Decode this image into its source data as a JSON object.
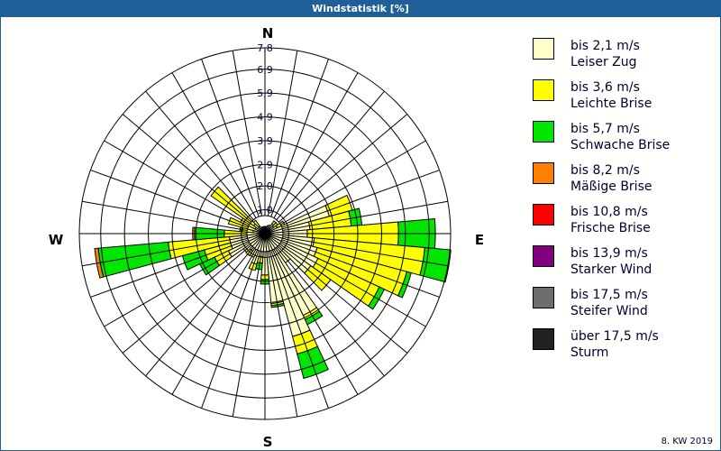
{
  "title": "Windstatistik [%]",
  "footer": "8. KW 2019",
  "chart_data": {
    "type": "windrose",
    "title": "Windstatistik [%]",
    "unit": "%",
    "compass_labels": {
      "n": "N",
      "e": "E",
      "s": "S",
      "w": "W"
    },
    "radial_ticks": [
      1.0,
      2.0,
      2.9,
      3.9,
      4.9,
      5.9,
      6.9,
      7.8
    ],
    "radial_tick_labels": [
      "1,0",
      "2,0",
      "2,9",
      "3,9",
      "4,9",
      "5,9",
      "6,9",
      "7,8"
    ],
    "rmax": 7.8,
    "grid": true,
    "legend_placement": "right",
    "directions": [
      0,
      10,
      20,
      30,
      40,
      50,
      60,
      70,
      80,
      90,
      100,
      110,
      120,
      130,
      140,
      150,
      160,
      170,
      180,
      190,
      200,
      210,
      220,
      230,
      240,
      250,
      260,
      270,
      280,
      290,
      300,
      310,
      320,
      330,
      340,
      350
    ],
    "series": [
      {
        "name": "bis 2,1 m/s",
        "desc": "Leiser Zug",
        "color": "#ffffc8",
        "values": [
          0.3,
          0.3,
          0.35,
          0.4,
          0.5,
          0.45,
          0.57,
          2.8,
          1.9,
          1.78,
          2.08,
          2.27,
          2.46,
          2.35,
          1.5,
          3.79,
          4.47,
          2.95,
          1.74,
          0.98,
          1.33,
          1.1,
          0.9,
          1.1,
          1.7,
          1.5,
          1.5,
          0.76,
          0.5,
          0.76,
          0.45,
          0.57,
          0.38,
          0.3,
          0.3,
          0.3
        ]
      },
      {
        "name": "bis 3,6 m/s",
        "desc": "Leichte Brise",
        "color": "#ffff00",
        "values": [
          0,
          0,
          0,
          0,
          0.15,
          0.2,
          0.34,
          1.0,
          1.74,
          3.83,
          4.66,
          3.9,
          2.84,
          1.02,
          0,
          0.19,
          0.76,
          0.08,
          0.19,
          0.27,
          0.27,
          0,
          0.23,
          0,
          0.64,
          1.14,
          2.58,
          0.95,
          0.45,
          0.83,
          0.68,
          2.2,
          0.3,
          0,
          0,
          0
        ]
      },
      {
        "name": "bis 5,7 m/s",
        "desc": "Schwache Brise",
        "color": "#00e600",
        "values": [
          0,
          0,
          0,
          0,
          0,
          0,
          0,
          0,
          0.45,
          1.55,
          1.1,
          0.19,
          0.23,
          0,
          0,
          0.23,
          1.06,
          0.08,
          0.19,
          0.27,
          0,
          0,
          0,
          0,
          0.68,
          0.95,
          2.95,
          1.25,
          0.11,
          0,
          0,
          0,
          0,
          0,
          0,
          0
        ]
      },
      {
        "name": "bis 8,2 m/s",
        "desc": "Mäßige Brise",
        "color": "#ff8000",
        "values": [
          0,
          0,
          0,
          0,
          0,
          0,
          0,
          0,
          0,
          0,
          0,
          0,
          0,
          0,
          0,
          0,
          0,
          0,
          0,
          0,
          0,
          0,
          0,
          0,
          0,
          0,
          0.15,
          0.08,
          0,
          0,
          0,
          0,
          0,
          0,
          0,
          0
        ]
      },
      {
        "name": "bis 10,8 m/s",
        "desc": "Frische Brise",
        "color": "#ff0000",
        "values": [
          0,
          0,
          0,
          0,
          0,
          0,
          0,
          0,
          0,
          0,
          0,
          0,
          0,
          0,
          0,
          0,
          0,
          0,
          0,
          0,
          0,
          0,
          0,
          0,
          0,
          0,
          0,
          0,
          0,
          0,
          0,
          0,
          0,
          0,
          0,
          0
        ]
      },
      {
        "name": "bis 13,9 m/s",
        "desc": "Starker Wind",
        "color": "#800080",
        "values": [
          0,
          0,
          0,
          0,
          0,
          0,
          0,
          0,
          0,
          0,
          0,
          0,
          0,
          0,
          0,
          0,
          0,
          0,
          0,
          0,
          0,
          0,
          0,
          0,
          0,
          0,
          0,
          0,
          0,
          0,
          0,
          0,
          0,
          0,
          0,
          0
        ]
      },
      {
        "name": "bis 17,5 m/s",
        "desc": "Steifer Wind",
        "color": "#6e6e6e",
        "values": [
          0,
          0,
          0,
          0,
          0,
          0,
          0,
          0,
          0,
          0,
          0,
          0,
          0,
          0,
          0,
          0,
          0,
          0,
          0,
          0,
          0,
          0,
          0,
          0,
          0,
          0,
          0,
          0,
          0,
          0,
          0,
          0,
          0,
          0,
          0,
          0
        ]
      },
      {
        "name": "über 17,5 m/s",
        "desc": "Sturm",
        "color": "#222222",
        "values": [
          0,
          0,
          0,
          0,
          0,
          0,
          0,
          0,
          0,
          0,
          0,
          0,
          0,
          0,
          0,
          0,
          0,
          0,
          0,
          0,
          0,
          0,
          0,
          0,
          0,
          0,
          0,
          0,
          0,
          0,
          0,
          0,
          0,
          0,
          0,
          0
        ]
      }
    ]
  }
}
